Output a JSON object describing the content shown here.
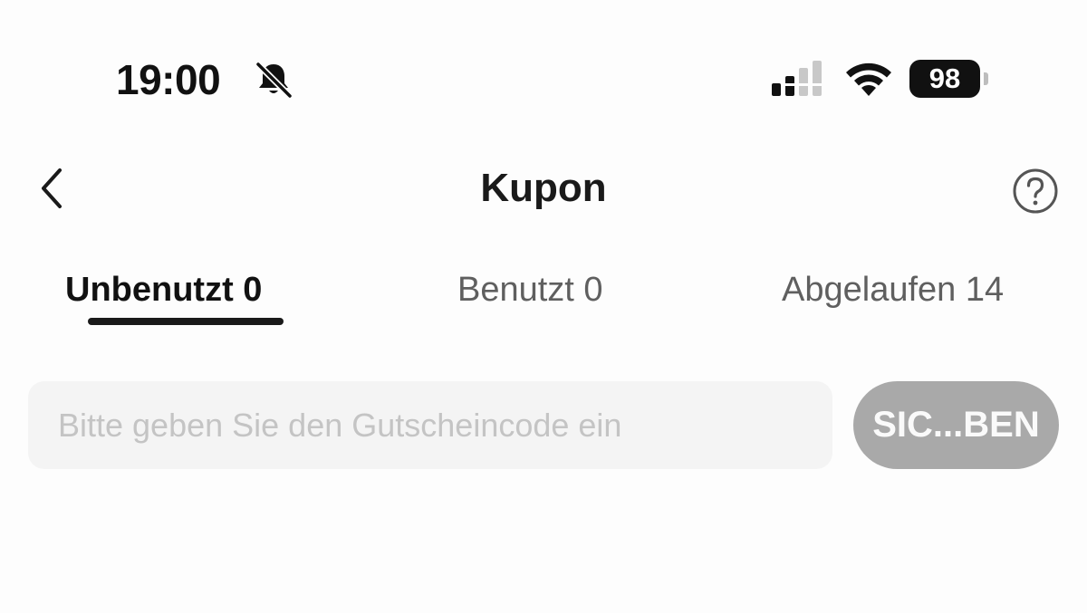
{
  "status_bar": {
    "time": "19:00",
    "battery_level": "98",
    "icons": [
      "bell-slash-icon",
      "cellular-signal-icon",
      "wifi-icon",
      "battery-icon"
    ]
  },
  "header": {
    "title": "Kupon",
    "back_icon": "chevron-left-icon",
    "help_icon": "question-circle-icon"
  },
  "tabs": [
    {
      "label": "Unbenutzt 0",
      "active": true
    },
    {
      "label": "Benutzt 0",
      "active": false
    },
    {
      "label": "Abgelaufen 14",
      "active": false
    }
  ],
  "coupon_form": {
    "placeholder": "Bitte geben Sie den Gutscheincode ein",
    "value": "",
    "submit_label": "SIC...BEN"
  },
  "colors": {
    "background": "#fdfdfd",
    "text_primary": "#1a1a1a",
    "tab_inactive": "#5f5f5f",
    "input_background": "#f4f4f4",
    "placeholder": "#c4c4c4",
    "button_disabled": "#a9a9a9"
  }
}
